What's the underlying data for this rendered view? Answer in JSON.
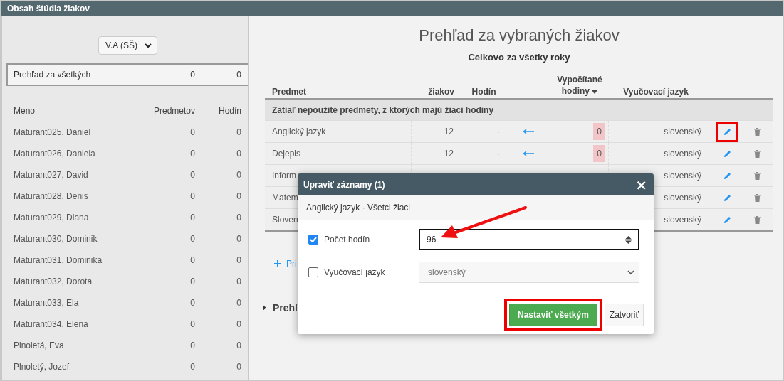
{
  "window": {
    "title": "Obsah štúdia žiakov"
  },
  "sidebar": {
    "class_select": "V.A (SŠ)",
    "summary": {
      "label": "Prehľad za všetkých",
      "subjects": "0",
      "hours": "0"
    },
    "columns": [
      "Meno",
      "Predmetov",
      "Hodín"
    ],
    "students": [
      {
        "name": "Maturant025, Daniel",
        "subjects": "0",
        "hours": "0"
      },
      {
        "name": "Maturant026, Daniela",
        "subjects": "0",
        "hours": "0"
      },
      {
        "name": "Maturant027, David",
        "subjects": "0",
        "hours": "0"
      },
      {
        "name": "Maturant028, Denis",
        "subjects": "0",
        "hours": "0"
      },
      {
        "name": "Maturant029, Diana",
        "subjects": "0",
        "hours": "0"
      },
      {
        "name": "Maturant030, Dominik",
        "subjects": "0",
        "hours": "0"
      },
      {
        "name": "Maturant031, Dominika",
        "subjects": "0",
        "hours": "0"
      },
      {
        "name": "Maturant032, Dorota",
        "subjects": "0",
        "hours": "0"
      },
      {
        "name": "Maturant033, Ela",
        "subjects": "0",
        "hours": "0"
      },
      {
        "name": "Maturant034, Elena",
        "subjects": "0",
        "hours": "0"
      },
      {
        "name": "Plnoletá, Eva",
        "subjects": "0",
        "hours": "0"
      },
      {
        "name": "Plnoletý, Jozef",
        "subjects": "0",
        "hours": "0"
      }
    ]
  },
  "main": {
    "title": "Prehľad za vybraných žiakov",
    "subtitle": "Celkovo za všetky roky",
    "table": {
      "columns": [
        "Predmet",
        "žiakov",
        "Hodín",
        "Vypočítané hodiny",
        "Vyučovací jazyk"
      ],
      "group": "Zatiaľ nepoužité predmety, z ktorých majú žiaci hodiny",
      "rows": [
        {
          "subject": "Anglický jazyk",
          "students": "12",
          "hours": "-",
          "computed": "0",
          "language": "slovenský",
          "highlighted": true
        },
        {
          "subject": "Dejepis",
          "students": "12",
          "hours": "-",
          "computed": "0",
          "language": "slovenský",
          "highlighted": false
        },
        {
          "subject": "Inform",
          "language": "slovenský",
          "highlighted": false
        },
        {
          "subject": "Matem",
          "language": "slovenský",
          "highlighted": false
        },
        {
          "subject": "Sloven",
          "language": "slovenský",
          "highlighted": false
        }
      ]
    },
    "add_link": "Pri",
    "section": "Prehľ"
  },
  "dialog": {
    "title": "Upraviť záznamy (1)",
    "close": "×",
    "context": "Anglický jazyk · Všetci žiaci",
    "fields": [
      {
        "kind": "number",
        "label": "Počet hodín",
        "checked": true,
        "value": "96"
      },
      {
        "kind": "select",
        "label": "Vyučovací jazyk",
        "checked": false,
        "value": "slovenský"
      }
    ],
    "primary": {
      "label": "Nastaviť všetkým",
      "highlighted": true
    },
    "secondary": "Zatvoriť"
  }
}
